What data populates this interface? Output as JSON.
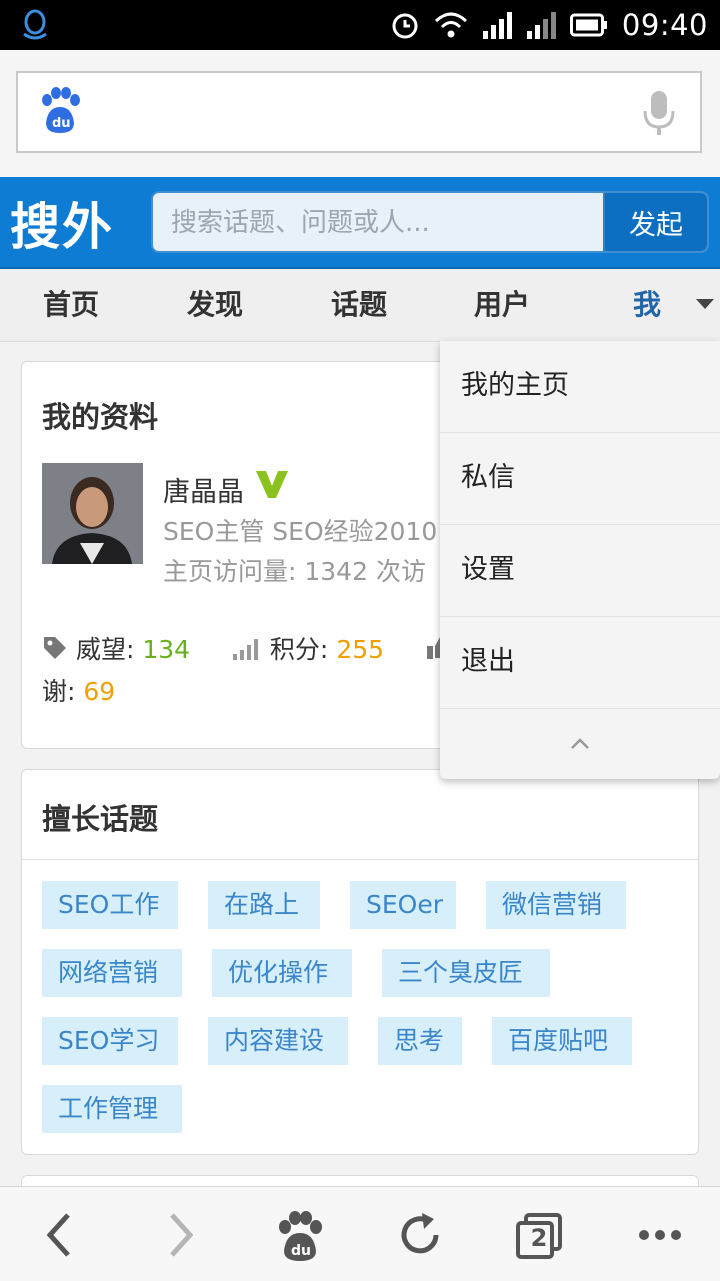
{
  "status_bar": {
    "time": "09:40",
    "icons": [
      "qq-icon",
      "alarm-icon",
      "wifi-icon",
      "signal-icon",
      "signal-icon",
      "battery-icon"
    ]
  },
  "browser": {
    "url_value": "",
    "logo_icon": "baidu-paw-icon",
    "mic_icon": "microphone-icon"
  },
  "site": {
    "logo": "搜外",
    "search_placeholder": "搜索话题、问题或人...",
    "search_button": "发起"
  },
  "nav": {
    "items": [
      "首页",
      "发现",
      "话题",
      "用户",
      "我"
    ],
    "active": "我"
  },
  "profile": {
    "title": "我的资料",
    "name": "唐晶晶",
    "description": "SEO主管 SEO经验2010",
    "visits": "主页访问量: 1342 次访",
    "prestige_label": "威望:",
    "prestige_value": "134",
    "points_label": "积分:",
    "points_value": "255",
    "thanks_label": "谢:",
    "thanks_value": "69"
  },
  "topics": {
    "title": "擅长话题",
    "tags": [
      "SEO工作",
      "在路上",
      "SEOer",
      "微信营销",
      "网络营销",
      "优化操作",
      "三个臭皮匠",
      "SEO学习",
      "内容建设",
      "思考",
      "百度贴吧",
      "工作管理"
    ]
  },
  "dropdown": {
    "items": [
      "我的主页",
      "私信",
      "设置",
      "退出"
    ]
  },
  "bottom_bar": {
    "tab_count": "2",
    "icons": [
      "back-icon",
      "forward-icon",
      "baidu-home-icon",
      "refresh-icon",
      "tabs-icon",
      "more-icon"
    ]
  },
  "colors": {
    "header_blue": "#0f7cd4",
    "tag_bg": "#d7eefb",
    "tag_text": "#3a86c8",
    "prestige_green": "#6ab01e",
    "points_orange": "#f0a000",
    "active_nav": "#2266aa"
  }
}
